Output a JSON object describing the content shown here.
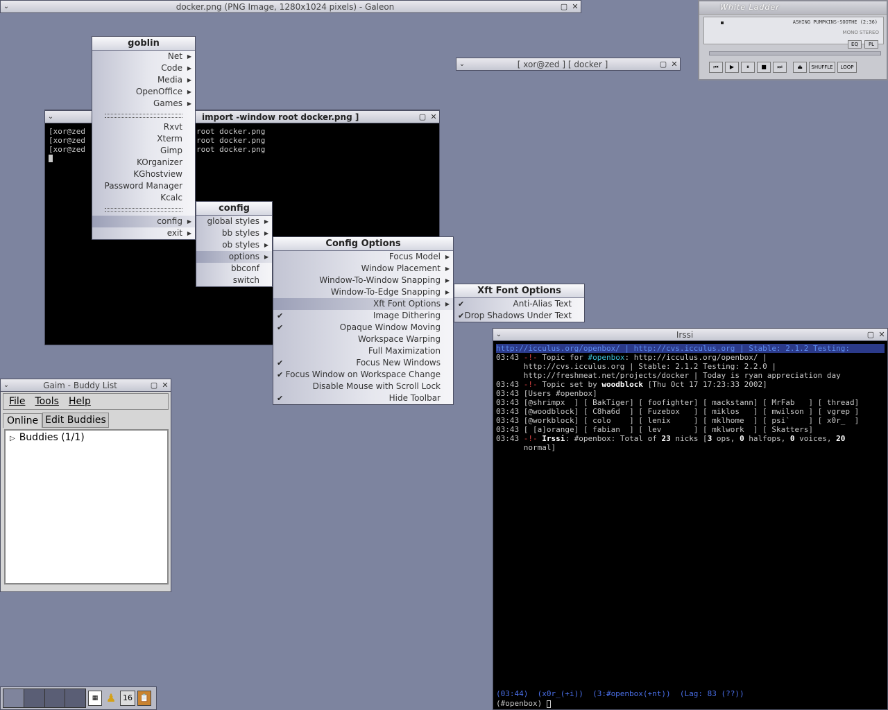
{
  "galeon": {
    "title": "docker.png (PNG Image, 1280x1024 pixels) - Galeon"
  },
  "docker_win": {
    "title": "[ xor@zed ] [ docker ]"
  },
  "terminal": {
    "title": "import -window root docker.png ]",
    "lines": [
      "[xor@zed",
      "[xor@zed",
      "[xor@zed"
    ],
    "right_lines": [
      "root docker.png",
      "root docker.png",
      "root docker.png"
    ]
  },
  "xmms": {
    "skin_title": "White Ladder",
    "track": "ASHING PUMPKINS-SOOTHE (2:36)",
    "mono_stereo": "MONO STEREO",
    "eq": "EQ",
    "pl": "PL",
    "shuffle": "SHUFFLE",
    "loop": "LOOP"
  },
  "root_menu": {
    "title": "goblin",
    "items_top": [
      "Net",
      "Code",
      "Media",
      "OpenOffice",
      "Games"
    ],
    "items_mid": [
      "Rxvt",
      "Xterm",
      "Gimp",
      "KOrganizer",
      "KGhostview",
      "Password Manager",
      "Kcalc"
    ],
    "config": "config",
    "exit": "exit"
  },
  "config_menu": {
    "title": "config",
    "items": [
      "global styles",
      "bb styles",
      "ob styles",
      "options",
      "bbconf",
      "switch"
    ]
  },
  "options_menu": {
    "title": "Config Options",
    "items": [
      "Focus Model",
      "Window Placement",
      "Window-To-Window Snapping",
      "Window-To-Edge Snapping",
      "Xft Font Options",
      "Image Dithering",
      "Opaque Window Moving",
      "Workspace Warping",
      "Full Maximization",
      "Focus New Windows",
      "Focus Window on Workspace Change",
      "Disable Mouse with Scroll Lock",
      "Hide Toolbar"
    ]
  },
  "xft_menu": {
    "title": "Xft Font Options",
    "items": [
      "Anti-Alias Text",
      "Drop Shadows Under Text"
    ]
  },
  "gaim": {
    "title": "Gaim - Buddy List",
    "menu": [
      "File",
      "Tools",
      "Help"
    ],
    "tabs": [
      "Online",
      "Edit Buddies"
    ],
    "group": "Buddies (1/1)"
  },
  "irssi": {
    "title": "Irssi",
    "topic_bar": "http://icculus.org/openbox/ | http://cvs.icculus.org | Stable: 2.1.2 Testing:",
    "lines": [
      {
        "time": "03:43",
        "parts": [
          [
            "c-red",
            " -!- "
          ],
          [
            "c-grey",
            "Topic for "
          ],
          [
            "c-cyan",
            "#openbox"
          ],
          [
            "c-grey",
            ": http://icculus.org/openbox/ |"
          ]
        ]
      },
      {
        "time": "",
        "parts": [
          [
            "c-grey",
            "      http://cvs.icculus.org | Stable: 2.1.2 Testing: 2.2.0 |"
          ]
        ]
      },
      {
        "time": "",
        "parts": [
          [
            "c-grey",
            "      http://freshmeat.net/projects/docker | Today is ryan appreciation day"
          ]
        ]
      },
      {
        "time": "03:43",
        "parts": [
          [
            "c-red",
            " -!- "
          ],
          [
            "c-grey",
            "Topic set by "
          ],
          [
            "c-white",
            "woodblock"
          ],
          [
            "c-grey",
            " [Thu Oct 17 17:23:33 2002]"
          ]
        ]
      },
      {
        "time": "03:43",
        "parts": [
          [
            "c-grey",
            " [Users #openbox]"
          ]
        ]
      },
      {
        "time": "03:43",
        "parts": [
          [
            "c-grey",
            " [@shrimpx  ] [ BakTiger] [ foofighter] [ mackstann] [ MrFab   ] [ thread]"
          ]
        ]
      },
      {
        "time": "03:43",
        "parts": [
          [
            "c-grey",
            " [@woodblock] [ C8ha6d  ] [ Fuzebox   ] [ miklos   ] [ mwilson ] [ vgrep ]"
          ]
        ]
      },
      {
        "time": "03:43",
        "parts": [
          [
            "c-grey",
            " [@workblock] [ colo    ] [ lenix     ] [ mklhome  ] [ psi`    ] [ x0r_  ]"
          ]
        ]
      },
      {
        "time": "03:43",
        "parts": [
          [
            "c-grey",
            " [ [a]orange] [ fabian  ] [ lev       ] [ mklwork  ] [ Skatters]"
          ]
        ]
      },
      {
        "time": "03:43",
        "parts": [
          [
            "c-red",
            " -!- "
          ],
          [
            "c-white",
            "Irssi"
          ],
          [
            "c-grey",
            ": #openbox: Total of "
          ],
          [
            "c-white",
            "23"
          ],
          [
            "c-grey",
            " nicks ["
          ],
          [
            "c-white",
            "3"
          ],
          [
            "c-grey",
            " ops, "
          ],
          [
            "c-white",
            "0"
          ],
          [
            "c-grey",
            " halfops, "
          ],
          [
            "c-white",
            "0"
          ],
          [
            "c-grey",
            " voices, "
          ],
          [
            "c-white",
            "20"
          ]
        ]
      },
      {
        "time": "",
        "parts": [
          [
            "c-grey",
            "      normal]"
          ]
        ]
      }
    ],
    "status": "(03:44)  (x0r_(+i))  (3:#openbox(+nt))  (Lag: 83 (??))",
    "prompt": "(#openbox) "
  },
  "taskbar": {
    "clock_num": "16"
  }
}
